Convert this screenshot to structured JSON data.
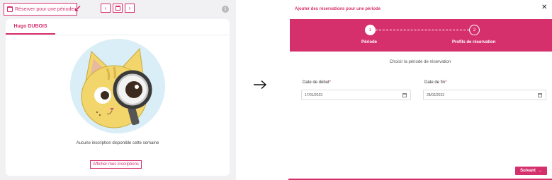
{
  "left": {
    "period_button_label": "Réserver pour une période",
    "tab_label": "Hugo DUBOIS",
    "empty_text": "Aucune inscription disponible cette semaine",
    "show_button_label": "Afficher mes inscriptions",
    "icons": [
      "calendar-icon",
      "chevron-left-icon",
      "calendar-icon",
      "chevron-right-icon",
      "info-icon"
    ]
  },
  "modal": {
    "title": "Ajouter des réservations pour une période",
    "close_symbol": "✕",
    "steps": [
      {
        "number": "1",
        "label": "Période"
      },
      {
        "number": "2",
        "label": "Profils de réservation"
      }
    ],
    "subtitle": "Choisir la période de réservation",
    "start": {
      "label": "Date de début",
      "required": "*",
      "value": "17/01/2023"
    },
    "end": {
      "label": "Date de fin",
      "required": "*",
      "value": "28/02/2023"
    },
    "next_label": "Suivant"
  },
  "colors": {
    "accent": "#d6306c",
    "mascot_yellow": "#f2d66b",
    "mascot_bg": "#d9eef6"
  }
}
